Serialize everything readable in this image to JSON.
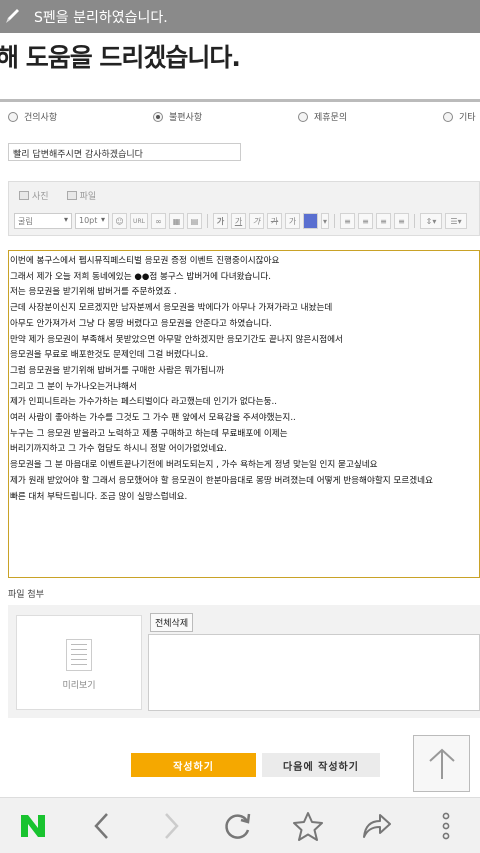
{
  "status": {
    "message": "S펜을 분리하였습니다.",
    "icon": "pen-icon"
  },
  "page": {
    "heading": "해 도움을 드리겠습니다."
  },
  "category": {
    "options": [
      "건의사항",
      "불편사항",
      "제휴문의",
      "기타"
    ],
    "selected": "불편사항"
  },
  "form": {
    "title_value": "빨리 답변해주시면 감사하겠습니다"
  },
  "toolbar": {
    "photo_label": "사진",
    "file_label": "파일",
    "font_select": "굴림",
    "size_select": "10pt",
    "url_label": "URL",
    "b1": "가",
    "b2": "가",
    "b3": "가",
    "b4": "가",
    "b5": "가"
  },
  "editor": {
    "lines": [
      "이번에 봉구스에서 펩시뮤직페스티벌 응모권 증정 이벤트 진행중이시잖아요",
      "그래서 제가 오늘 저희 동네에있는 ●●점 봉구스 밥버거에 다녀왔습니다.",
      "저는 응모권을 받기위해 밥버거를 주문하였죠 .",
      "근데 사장분이신지 모르겠지만 남자분께서 응모권을 박에다가 아무나 가져가라고 내놨는데",
      "아무도 안가져가서 그냥 다 몽땅 버렸다고 응모권을 안준다고 하였습니다.",
      "만약 제가 응모권이 부족해서 못받았으면 아무말 안하겠지만 응모기간도 끝나지 않은시점에서",
      "응모권을 무료로 배포한것도 문제인데 그걸 버렸다니요.",
      "그럼 응모권을 받기위해 밥버거를 구매한 사람은 뭐가됩니까",
      "그리고 그 분이 누가나오는거냐해서",
      "제가 인피니트라는 가수가하는 페스티벌이다 라고했는데 인기가 없다는둥..",
      "여러 사람이 좋아하는 가수를 그것도 그 가수 팬 앞에서 모욕감을 주셔야했는지..",
      "누구는 그 응모권 받을라고 노력하고 제품 구매하고 하는데 무료배포에 이제는",
      "버리기까지하고 그 가수 험담도 하시니 정말 어이가없었네요.",
      "응모권을 그 분 마음대로 이벤트끝나기전에 버려도되는지 , 가수 욕하는게 정녕 맞는일 인지 묻고싶네요",
      "제가 원래 받았어야 할 그래서 응모했어야 할 응모권이 한분마음대로 몽땅 버려졌는데 어떻게 반응해야할지 모르겠네요",
      "빠른 대처 부탁드립니다. 조금 많이 실망스럽네요."
    ]
  },
  "attachment": {
    "label": "파일 첨부",
    "preview_label": "미리보기",
    "delete_all": "전체삭제"
  },
  "actions": {
    "submit": "작성하기",
    "write_later": "다음에 작성하기"
  },
  "colors": {
    "accent": "#f5a800",
    "naver_green": "#19c32f",
    "editor_border": "#c9a227"
  }
}
